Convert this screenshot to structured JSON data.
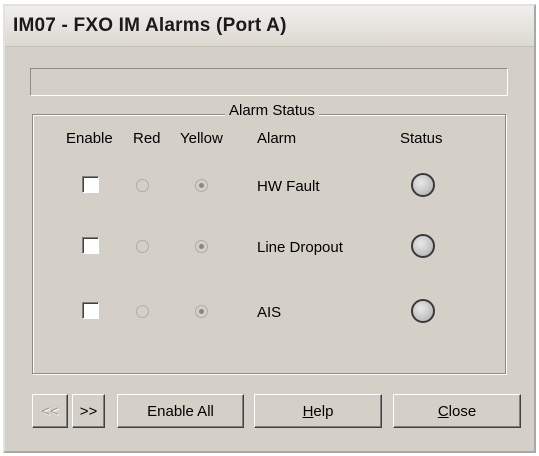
{
  "window": {
    "title": "IM07 - FXO IM Alarms (Port A)",
    "message": ""
  },
  "group": {
    "legend": "Alarm Status",
    "headers": {
      "enable": "Enable",
      "red": "Red",
      "yellow": "Yellow",
      "alarm": "Alarm",
      "status": "Status"
    },
    "rows": [
      {
        "alarm": "HW Fault",
        "enabled": false,
        "severity": "Yellow",
        "status_color": "#c4c4c4"
      },
      {
        "alarm": "Line Dropout",
        "enabled": false,
        "severity": "Yellow",
        "status_color": "#c4c4c4"
      },
      {
        "alarm": "AIS",
        "enabled": false,
        "severity": "Yellow",
        "status_color": "#c4c4c4"
      }
    ]
  },
  "buttons": {
    "prev": "<<",
    "next": ">>",
    "enable_all": "Enable All",
    "help_mnemonic": "H",
    "help_rest": "elp",
    "close_mnemonic": "C",
    "close_rest": "lose"
  },
  "colors": {
    "face": "#d4d0c8",
    "led_off": "#c4c4c4"
  }
}
